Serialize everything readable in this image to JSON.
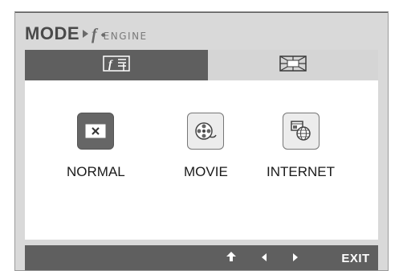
{
  "title": {
    "main": "MODE",
    "f_glyph": "f",
    "sub": "ENGINE"
  },
  "tabs": [
    {
      "icon": "f-engine-icon",
      "active": true
    },
    {
      "icon": "picture-adjust-icon",
      "active": false
    }
  ],
  "modes": [
    {
      "label": "NORMAL",
      "icon": "normal-mode-icon",
      "selected": true
    },
    {
      "label": "MOVIE",
      "icon": "movie-reel-icon",
      "selected": false
    },
    {
      "label": "INTERNET",
      "icon": "internet-globe-icon",
      "selected": false
    }
  ],
  "footer": {
    "buttons": [
      {
        "icon": "up-arrow-icon"
      },
      {
        "icon": "left-arrow-icon"
      },
      {
        "icon": "right-arrow-icon"
      }
    ],
    "exit_label": "EXIT"
  },
  "colors": {
    "frame_bg": "#d9d9d9",
    "dark_bar": "#5f5f5f",
    "panel_bg": "#ffffff",
    "selected_icon_bg": "#666666"
  }
}
